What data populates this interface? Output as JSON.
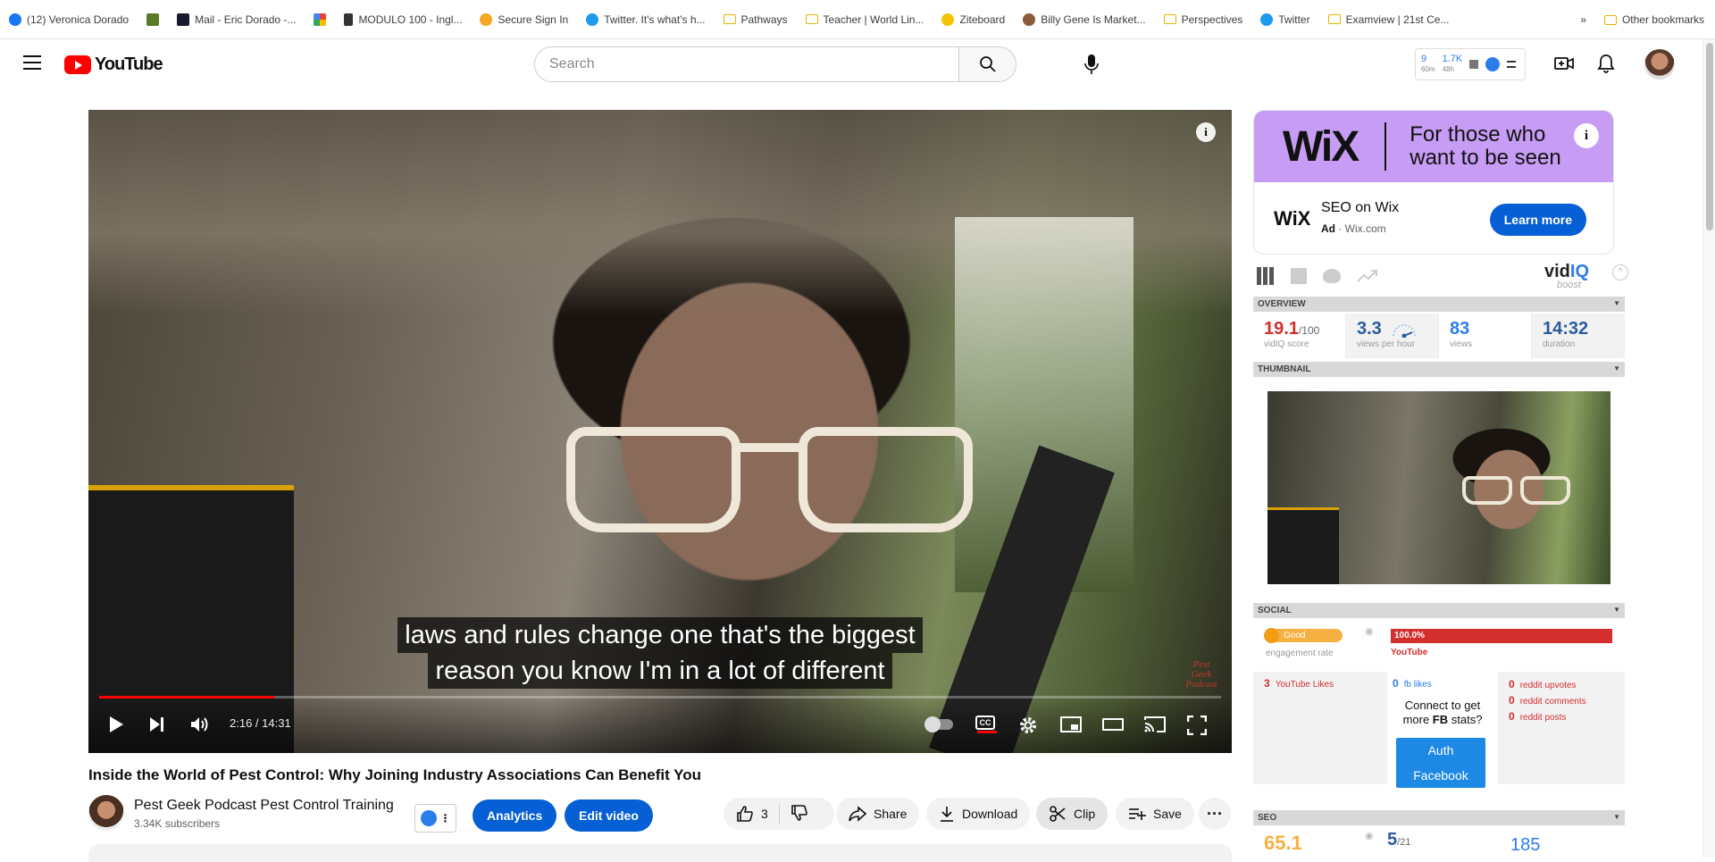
{
  "bookmarks": {
    "items": [
      {
        "label": "(12) Veronica Dorado",
        "color": "#1877f2"
      },
      {
        "label": "",
        "color": "#5a7a2a"
      },
      {
        "label": "Mail - Eric Dorado -...",
        "color": "#1a1a2e"
      },
      {
        "label": "",
        "color": "#4285f4"
      },
      {
        "label": "MODULO 100 - Ingl...",
        "color": "#333333"
      },
      {
        "label": "Secure Sign In",
        "color": "#f5a623"
      },
      {
        "label": "Twitter. It's what's h...",
        "color": "#1d9bf0"
      },
      {
        "label": "Pathways",
        "color": "folder"
      },
      {
        "label": "Teacher | World Lin...",
        "color": "folder"
      },
      {
        "label": "Ziteboard",
        "color": "#f5c400"
      },
      {
        "label": "Billy Gene Is Market...",
        "color": "#8a5a3a"
      },
      {
        "label": "Perspectives",
        "color": "folder"
      },
      {
        "label": "Twitter",
        "color": "#1d9bf0"
      },
      {
        "label": "Examview | 21st Ce...",
        "color": "folder"
      }
    ],
    "overflow": "»",
    "other": "Other bookmarks"
  },
  "header": {
    "logo_text": "YouTube",
    "search_placeholder": "Search",
    "vidiq_stats": [
      {
        "value": "9",
        "sub": "60m"
      },
      {
        "value": "1.7K",
        "sub": "48h"
      }
    ]
  },
  "player": {
    "caption_lines": [
      "laws and rules change one that's the biggest",
      "reason you know I'm in a lot of different"
    ],
    "time": "2:16 / 14:31",
    "progress": 0.156,
    "cc_label": "CC",
    "watermark": "Pest Geek Podcast"
  },
  "video": {
    "title": "Inside the World of Pest Control: Why Joining Industry Associations Can Benefit You",
    "channel": "Pest Geek Podcast Pest Control Training",
    "subscribers": "3.34K subscribers",
    "analytics_label": "Analytics",
    "edit_label": "Edit video",
    "like_count": "3",
    "share_label": "Share",
    "download_label": "Download",
    "clip_label": "Clip",
    "save_label": "Save"
  },
  "ad": {
    "logo": "WiX",
    "tagline_1": "For those who",
    "tagline_2": "want to be seen",
    "small_logo": "WiX",
    "title": "SEO on Wix",
    "ad_label": "Ad",
    "domain": " · Wix.com",
    "cta": "Learn more"
  },
  "vidiq": {
    "brand_a": "vid",
    "brand_b": "IQ",
    "boost": "boost",
    "sections": {
      "overview": "OVERVIEW",
      "thumbnail": "THUMBNAIL",
      "social": "SOCIAL",
      "seo": "SEO"
    },
    "overview": {
      "score": "19.1",
      "score_max": "/100",
      "score_label": "vidIQ score",
      "vph": "3.3",
      "vph_label": "views per hour",
      "views": "83",
      "views_label": "views",
      "duration": "14:32",
      "duration_label": "duration"
    },
    "social": {
      "engagement_badge": "Good",
      "engagement_label": "engagement rate",
      "yt_percent": "100.0%",
      "yt_label": "YouTube",
      "yt_likes": "3",
      "yt_likes_label": "YouTube Likes",
      "fb_likes": "0",
      "fb_likes_label": "fb likes",
      "reddit_upvotes": "0",
      "reddit_upvotes_label": "reddit upvotes",
      "reddit_comments": "0",
      "reddit_comments_label": "reddit comments",
      "reddit_posts": "0",
      "reddit_posts_label": "reddit posts",
      "fb_connect_1": "Connect to get",
      "fb_connect_2a": "more ",
      "fb_connect_2b": "FB",
      "fb_connect_2c": " stats?",
      "fb_btn_1": "Auth",
      "fb_btn_2": "Facebook"
    },
    "seo": {
      "a": "65.1",
      "b": "5",
      "b_max": "/21",
      "c": "185"
    }
  }
}
